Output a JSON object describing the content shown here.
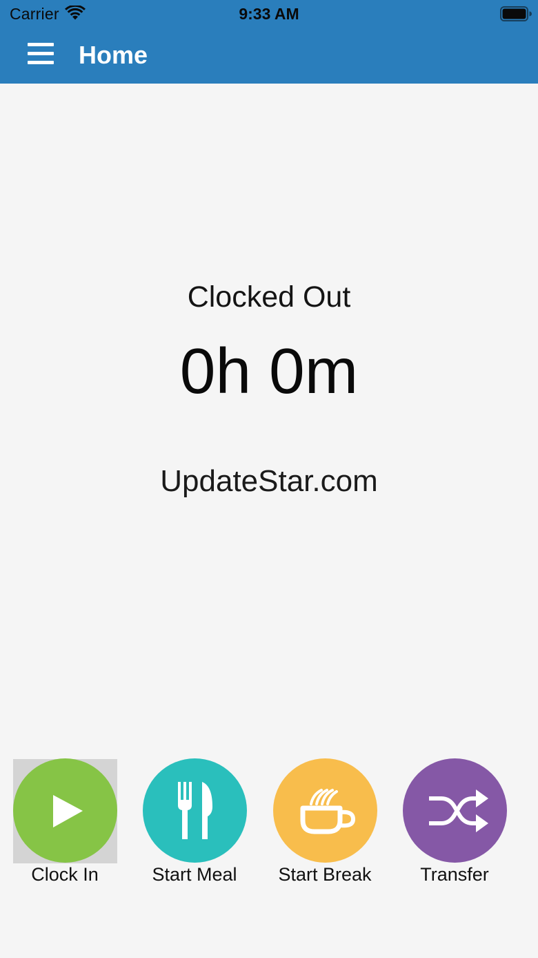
{
  "status_bar": {
    "carrier": "Carrier",
    "time": "9:33 AM",
    "wifi_icon": "wifi-icon",
    "battery_icon": "battery-icon"
  },
  "header": {
    "title": "Home",
    "menu_icon": "hamburger-menu-icon",
    "background_color": "#2a7ebc"
  },
  "main": {
    "status": "Clocked Out",
    "duration": "0h 0m",
    "company": "UpdateStar.com"
  },
  "actions": [
    {
      "label": "Clock In",
      "icon": "play-icon",
      "color": "#86c446"
    },
    {
      "label": "Start Meal",
      "icon": "fork-knife-icon",
      "color": "#2abfbc"
    },
    {
      "label": "Start Break",
      "icon": "coffee-cup-icon",
      "color": "#f8bd4c"
    },
    {
      "label": "Transfer",
      "icon": "shuffle-icon",
      "color": "#8558a6"
    }
  ]
}
